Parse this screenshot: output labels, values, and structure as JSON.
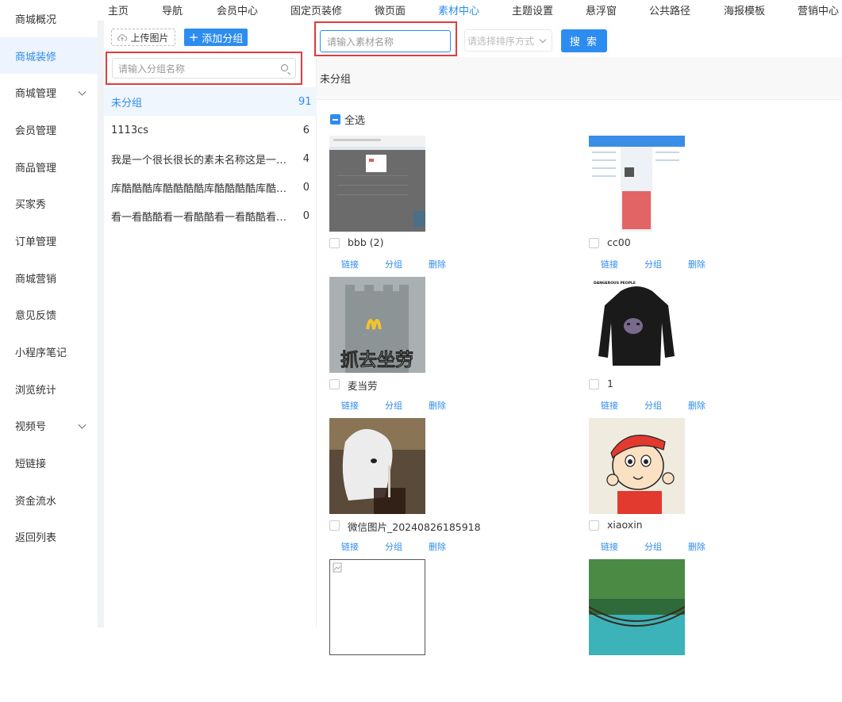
{
  "sidebar": {
    "items": [
      {
        "label": "商城概况",
        "active": false,
        "chevron": false
      },
      {
        "label": "商城装修",
        "active": true,
        "chevron": false
      },
      {
        "label": "商城管理",
        "active": false,
        "chevron": true
      },
      {
        "label": "会员管理",
        "active": false,
        "chevron": false
      },
      {
        "label": "商品管理",
        "active": false,
        "chevron": false
      },
      {
        "label": "买家秀",
        "active": false,
        "chevron": false
      },
      {
        "label": "订单管理",
        "active": false,
        "chevron": false
      },
      {
        "label": "商城营销",
        "active": false,
        "chevron": false
      },
      {
        "label": "意见反馈",
        "active": false,
        "chevron": false
      },
      {
        "label": "小程序笔记",
        "active": false,
        "chevron": false
      },
      {
        "label": "浏览统计",
        "active": false,
        "chevron": false
      },
      {
        "label": "视频号",
        "active": false,
        "chevron": true
      },
      {
        "label": "短链接",
        "active": false,
        "chevron": false
      },
      {
        "label": "资金流水",
        "active": false,
        "chevron": false
      },
      {
        "label": "返回列表",
        "active": false,
        "chevron": false
      }
    ]
  },
  "topnav": {
    "items": [
      {
        "label": "主页",
        "active": false
      },
      {
        "label": "导航",
        "active": false
      },
      {
        "label": "会员中心",
        "active": false
      },
      {
        "label": "固定页装修",
        "active": false
      },
      {
        "label": "微页面",
        "active": false
      },
      {
        "label": "素材中心",
        "active": true
      },
      {
        "label": "主题设置",
        "active": false
      },
      {
        "label": "悬浮窗",
        "active": false
      },
      {
        "label": "公共路径",
        "active": false
      },
      {
        "label": "海报模板",
        "active": false
      },
      {
        "label": "营销中心",
        "active": false
      }
    ]
  },
  "groups": {
    "upload_label": "上传图片",
    "add_label": "添加分组",
    "search_placeholder": "请输入分组名称",
    "items": [
      {
        "name": "未分组",
        "count": "91",
        "active": true
      },
      {
        "name": "1113cs",
        "count": "6",
        "active": false
      },
      {
        "name": "我是一个很长很长的素未名称这是一个很长很长的素未名称",
        "count": "4",
        "active": false
      },
      {
        "name": "库酷酷酷库酷酷酷酷库酷酷酷酷库酷酷酷酷",
        "count": "0",
        "active": false
      },
      {
        "name": "看一看酷酷看一看酷酷看一看酷酷看一看酷酷",
        "count": "0",
        "active": false
      }
    ]
  },
  "toolbar": {
    "asset_search_placeholder": "请输入素材名称",
    "sort_placeholder": "请选择排序方式",
    "search_label": "搜 索"
  },
  "content": {
    "section_title": "未分组",
    "select_all_label": "全选",
    "action_labels": {
      "link": "链接",
      "group": "分组",
      "delete": "删除"
    },
    "assets": [
      {
        "name": "bbb (2)",
        "thumb": "screenshot-dark"
      },
      {
        "name": "cc00",
        "thumb": "mobile-screens"
      },
      {
        "name": "麦当劳",
        "thumb": "castle-meme",
        "overlay_text": "抓去坐劳"
      },
      {
        "name": "1",
        "thumb": "black-hoodie",
        "brand_text": "DANGEROUS PEOPLE"
      },
      {
        "name": "微信图片_20240826185918",
        "thumb": "dog-drink"
      },
      {
        "name": "xiaoxin",
        "thumb": "cartoon-boy"
      },
      {
        "name": "",
        "thumb": "broken-image"
      },
      {
        "name": "",
        "thumb": "forest-bridge"
      }
    ]
  },
  "colors": {
    "accent": "#2d8cf0",
    "highlight_box": "#e03c3c"
  }
}
